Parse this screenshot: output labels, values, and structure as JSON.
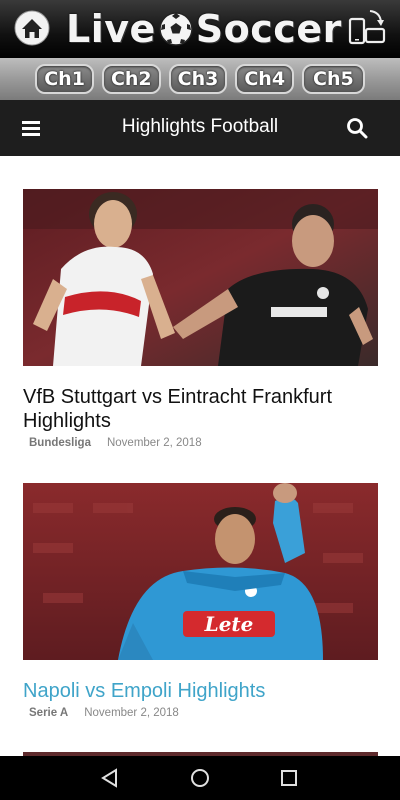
{
  "app": {
    "title_part1": "Live",
    "title_part2": "Soccer",
    "channels": [
      "Ch1",
      "Ch2",
      "Ch3",
      "Ch4",
      "Ch5"
    ]
  },
  "toolbar": {
    "title": "Highlights Football"
  },
  "articles": [
    {
      "title": "VfB Stuttgart vs Eintracht Frankfurt Highlights",
      "category": "Bundesliga",
      "date": "November 2, 2018"
    },
    {
      "title": "Napoli vs Empoli Highlights",
      "category": "Serie A",
      "date": "November 2, 2018"
    }
  ],
  "colors": {
    "toolbar": "#1e1e1e",
    "link_accent": "#3fa4c9"
  }
}
